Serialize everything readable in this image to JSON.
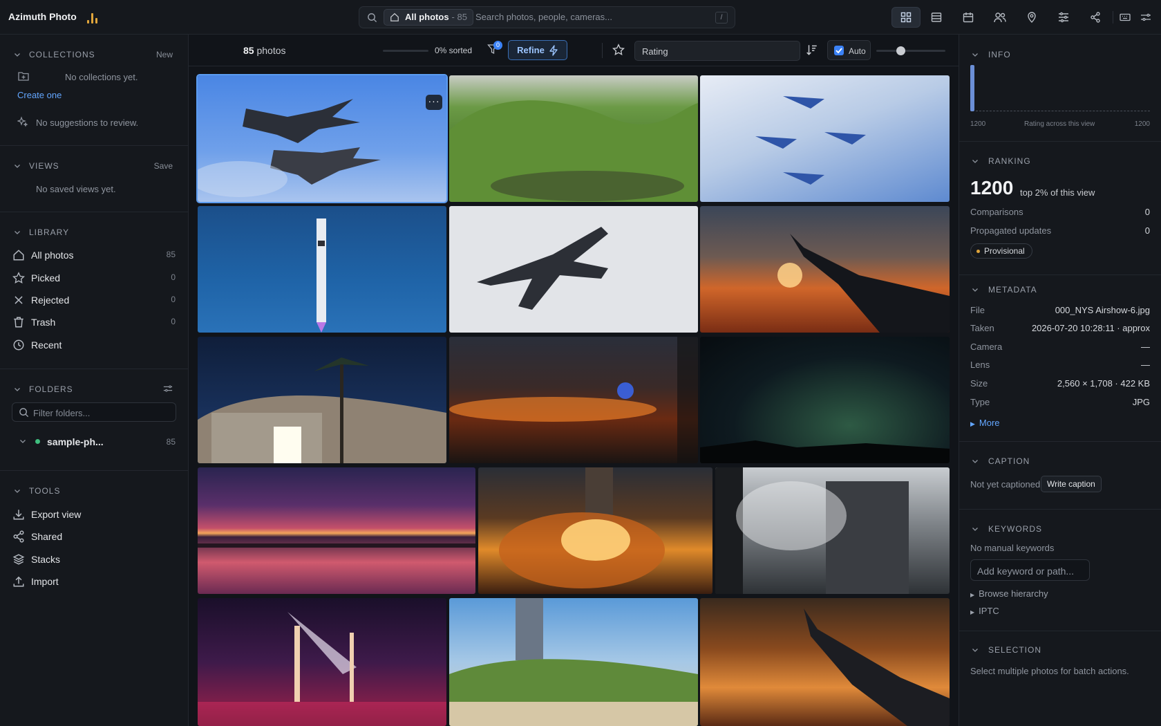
{
  "app": {
    "title": "Azimuth Photo"
  },
  "search": {
    "scope_label": "All photos",
    "scope_count": "- 85",
    "placeholder": "Search photos, people, cameras...",
    "shortcut": "/"
  },
  "toolbar_icons": [
    "grid-view-icon",
    "table-view-icon",
    "calendar-icon",
    "people-icon",
    "map-pin-icon",
    "adjustments-icon",
    "share-icon",
    "keyboard-icon",
    "settings-icon"
  ],
  "sidebar": {
    "collections": {
      "title": "COLLECTIONS",
      "action": "New",
      "empty": "No collections yet.",
      "create": "Create one",
      "suggestions": "No suggestions to review."
    },
    "views": {
      "title": "VIEWS",
      "action": "Save",
      "empty": "No saved views yet."
    },
    "library": {
      "title": "LIBRARY",
      "items": [
        {
          "label": "All photos",
          "count": "85",
          "icon": "home-icon"
        },
        {
          "label": "Picked",
          "count": "0",
          "icon": "star-icon"
        },
        {
          "label": "Rejected",
          "count": "0",
          "icon": "x-icon"
        },
        {
          "label": "Trash",
          "count": "0",
          "icon": "trash-icon"
        },
        {
          "label": "Recent",
          "count": "",
          "icon": "clock-icon"
        }
      ]
    },
    "folders": {
      "title": "FOLDERS",
      "filter_placeholder": "Filter folders...",
      "items": [
        {
          "label": "sample-ph...",
          "count": "85"
        }
      ]
    },
    "tools": {
      "title": "TOOLS",
      "items": [
        {
          "label": "Export view",
          "icon": "download-icon"
        },
        {
          "label": "Shared",
          "icon": "share-icon"
        },
        {
          "label": "Stacks",
          "icon": "layers-icon"
        },
        {
          "label": "Import",
          "icon": "upload-icon"
        }
      ]
    }
  },
  "grid_toolbar": {
    "count": "85",
    "count_label": "photos",
    "sorted_pct": 0,
    "sorted_label": "0% sorted",
    "filter_badge": "0",
    "refine": "Refine",
    "rating_select": "Rating",
    "auto_label": "Auto",
    "auto_checked": true,
    "size_slider": 0.35
  },
  "photos": [
    {
      "subject": "Jet and propeller plane over blue sky",
      "selected": true
    },
    {
      "subject": "Green hills above a pond"
    },
    {
      "subject": "Formation of jets in cloudy sky"
    },
    {
      "subject": "Rocket launch against blue sky"
    },
    {
      "subject": "Fighter jet on grey sky"
    },
    {
      "subject": "Airplane wing at orange sunset"
    },
    {
      "subject": "Lit building under palm tree at night"
    },
    {
      "subject": "City lights through plane window"
    },
    {
      "subject": "Starry night sky over dark hills"
    },
    {
      "subject": "Purple sunset reflected on water"
    },
    {
      "subject": "Rocket launch fire and smoke"
    },
    {
      "subject": "Launch tower with steam"
    },
    {
      "subject": "Launch pad with searchlights at night"
    },
    {
      "subject": "Launch tower over grassy dune"
    },
    {
      "subject": "Airplane wing over city lights at night"
    }
  ],
  "info": {
    "title": "INFO",
    "axis_min": "1200",
    "axis_caption": "Rating across this view",
    "axis_max": "1200",
    "ranking": {
      "title": "RANKING",
      "score": "1200",
      "rank_text": "top 2% of this view",
      "comparisons_label": "Comparisons",
      "comparisons": "0",
      "propagated_label": "Propagated updates",
      "propagated": "0",
      "status": "Provisional"
    },
    "metadata": {
      "title": "METADATA",
      "rows": [
        {
          "k": "File",
          "v": "000_NYS Airshow-6.jpg"
        },
        {
          "k": "Taken",
          "v": "2026-07-20 10:28:11 · approx"
        },
        {
          "k": "Camera",
          "v": "—"
        },
        {
          "k": "Lens",
          "v": "—"
        },
        {
          "k": "Size",
          "v": "2,560 × 1,708 · 422 KB"
        },
        {
          "k": "Type",
          "v": "JPG"
        }
      ],
      "more": "More"
    },
    "caption": {
      "title": "CAPTION",
      "empty": "Not yet captioned",
      "button": "Write caption"
    },
    "keywords": {
      "title": "KEYWORDS",
      "empty": "No manual keywords",
      "placeholder": "Add keyword or path...",
      "browse": "Browse hierarchy",
      "iptc": "IPTC"
    },
    "selection": {
      "title": "SELECTION",
      "hint": "Select multiple photos for batch actions."
    }
  }
}
